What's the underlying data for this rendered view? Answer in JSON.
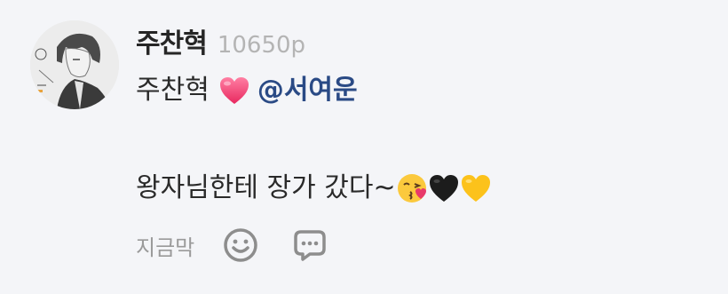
{
  "comment": {
    "author": "주찬혁",
    "points": "10650p",
    "body_line1_text": "주찬혁",
    "mention": "@서여운",
    "body_line2_text": "왕자님한테 장가 갔다~",
    "time": "지금막",
    "icons": {
      "avatar": "avatar-image",
      "heart": "pink-heart-emoji",
      "kiss": "kissing-face-emoji",
      "black_heart": "black-heart-emoji",
      "yellow_heart": "yellow-heart-emoji",
      "like": "smiley-icon",
      "reply": "speech-bubble-icon"
    }
  },
  "colors": {
    "background": "#f4f5f8",
    "author": "#262626",
    "points": "#b4b4b4",
    "mention": "#2a4a85",
    "time": "#9a9a9a",
    "icon": "#8d8d8d"
  }
}
